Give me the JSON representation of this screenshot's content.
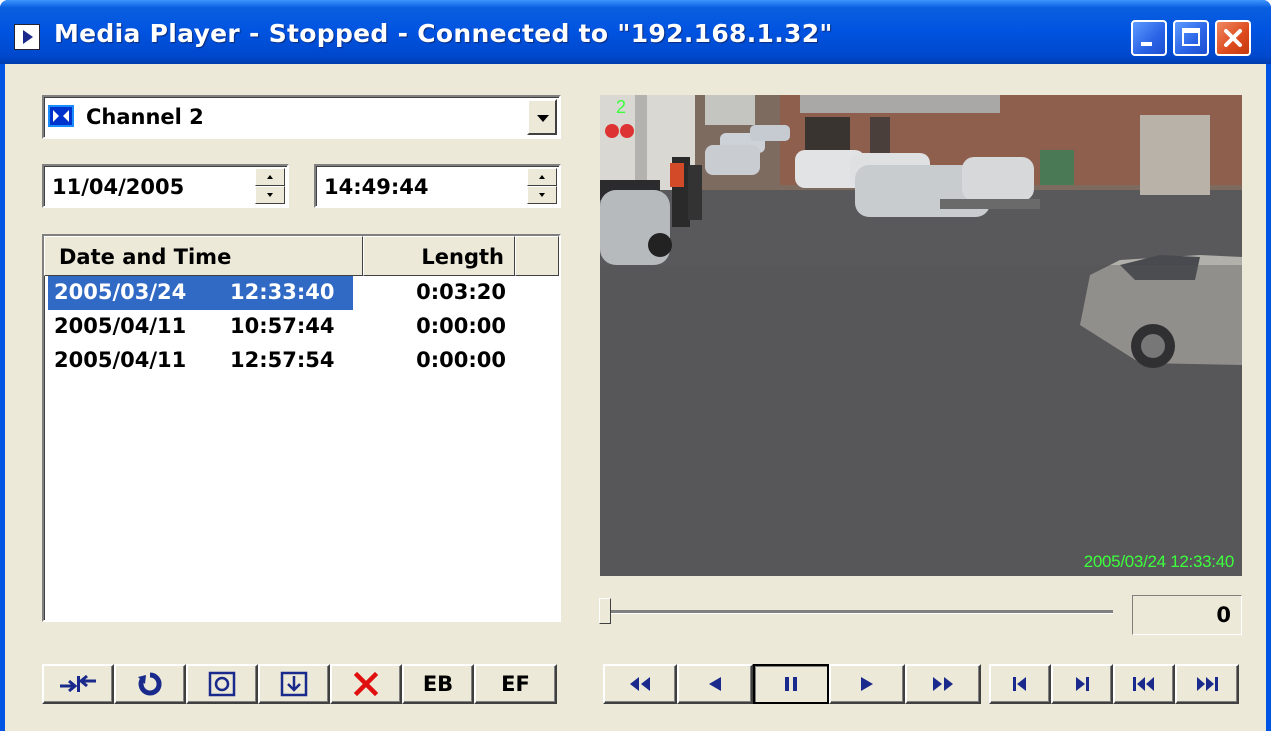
{
  "window": {
    "title": "Media Player - Stopped - Connected to \"192.168.1.32\"",
    "icon": "media-player-icon",
    "controls": [
      "minimize-icon",
      "maximize-icon",
      "close-icon"
    ]
  },
  "channel_select": {
    "value": "Channel 2",
    "icon": "camera-channel-icon"
  },
  "date_field": {
    "value": "11/04/2005"
  },
  "time_field": {
    "value": "14:49:44"
  },
  "recordings": {
    "columns": [
      "Date and Time",
      "Length"
    ],
    "rows": [
      {
        "date": "2005/03/24",
        "time": "12:33:40",
        "length": "0:03:20",
        "selected": true
      },
      {
        "date": "2005/04/11",
        "time": "10:57:44",
        "length": "0:00:00",
        "selected": false
      },
      {
        "date": "2005/04/11",
        "time": "12:57:54",
        "length": "0:00:00",
        "selected": false
      }
    ]
  },
  "left_toolbar": [
    {
      "name": "connect-icon"
    },
    {
      "name": "refresh-icon"
    },
    {
      "name": "snapshot-icon"
    },
    {
      "name": "download-icon"
    },
    {
      "name": "delete-icon"
    },
    {
      "label": "EB"
    },
    {
      "label": "EF"
    }
  ],
  "video": {
    "channel_overlay": "2",
    "timestamp_overlay": "2005/03/24 12:33:40",
    "overlay_color": "#3cff3c"
  },
  "playback": {
    "position_counter": "0",
    "position_fraction": 0.0
  },
  "transport_buttons": [
    "fast-rewind-icon",
    "play-backward-icon",
    "pause-icon",
    "play-icon",
    "fast-forward-icon",
    "step-back-icon",
    "step-forward-icon",
    "go-to-start-icon",
    "go-to-end-icon"
  ],
  "colors": {
    "selection": "#316ac5",
    "titlebar": "#0054e3",
    "face": "#ece9d8"
  }
}
